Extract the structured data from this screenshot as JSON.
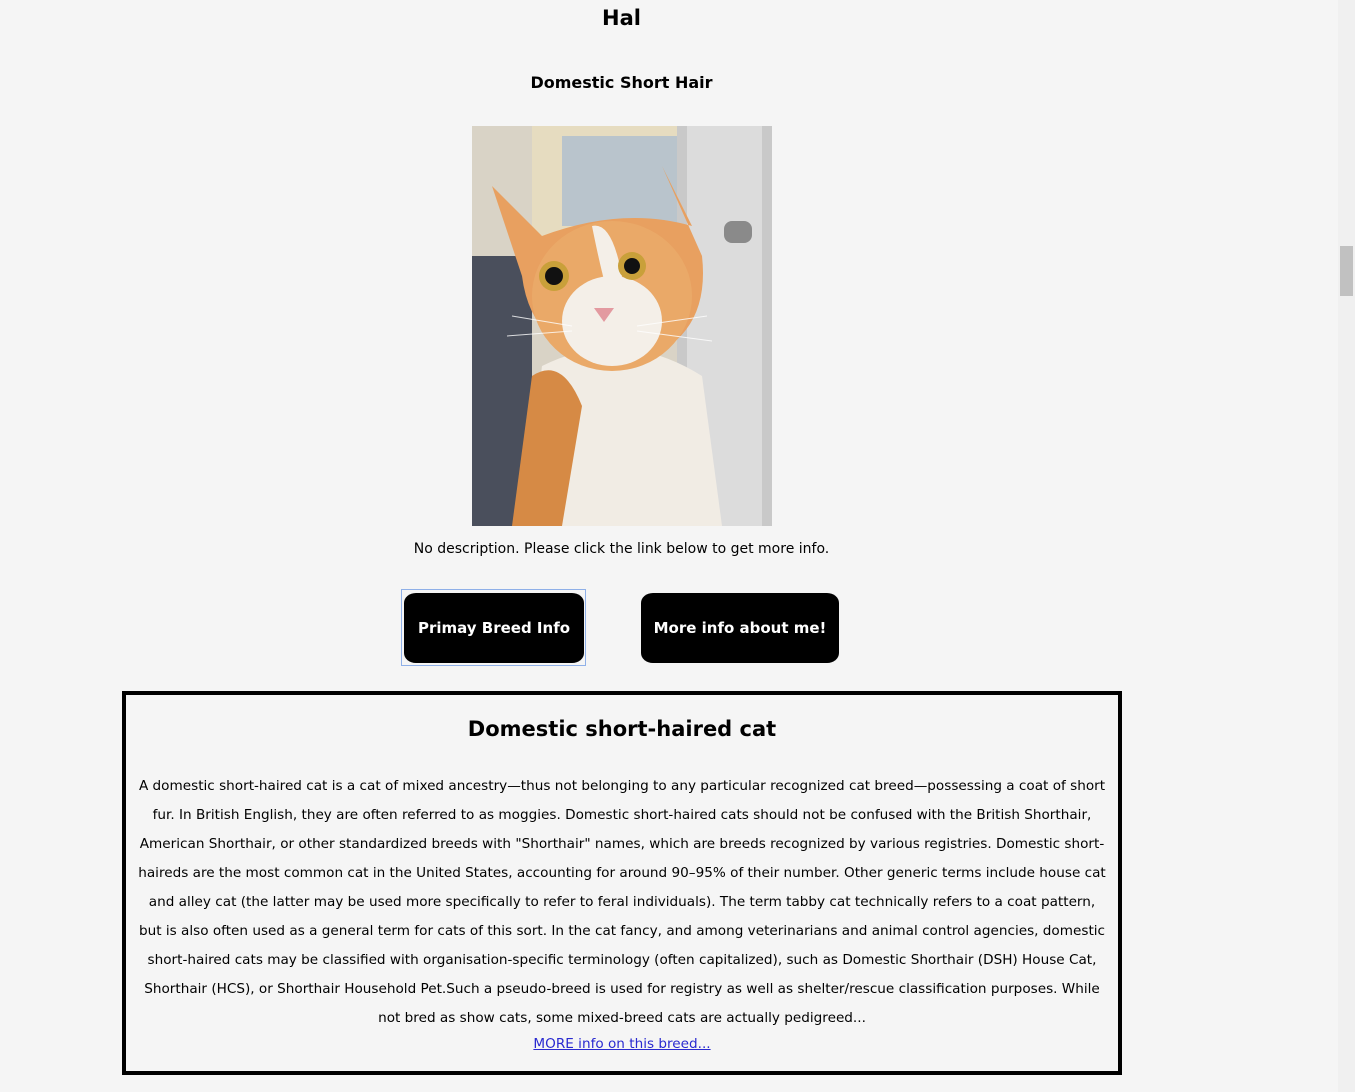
{
  "pet": {
    "name": "Hal",
    "breed": "Domestic Short Hair",
    "description": "No description. Please click the link below to get more info."
  },
  "buttons": {
    "breed_info": "Primay Breed Info",
    "more_info": "More info about me!"
  },
  "breed_info": {
    "title": "Domestic short-haired cat",
    "text": "A domestic short-haired cat is a cat of mixed ancestry—thus not belonging to any particular recognized cat breed—possessing a coat of short fur. In British English, they are often referred to as moggies. Domestic short-haired cats should not be confused with the British Shorthair, American Shorthair, or other standardized breeds with \"Shorthair\" names, which are breeds recognized by various registries. Domestic short-haireds are the most common cat in the United States, accounting for around 90–95% of their number. Other generic terms include house cat and alley cat (the latter may be used more specifically to refer to feral individuals). The term tabby cat technically refers to a coat pattern, but is also often used as a general term for cats of this sort. In the cat fancy, and among veterinarians and animal control agencies, domestic short-haired cats may be classified with organisation-specific terminology (often capitalized), such as Domestic Shorthair (DSH) House Cat, Shorthair (HCS), or Shorthair Household Pet.Such a pseudo-breed is used for registry as well as shelter/rescue classification purposes. While not bred as show cats, some mixed-breed cats are actually pedigreed...",
    "link_label": "MORE info on this breed..."
  },
  "colors": {
    "background": "#f5f5f5",
    "button_bg": "#000000",
    "button_text": "#ffffff",
    "link": "#2a2ad0",
    "focus_ring": "#8fb0e8"
  }
}
